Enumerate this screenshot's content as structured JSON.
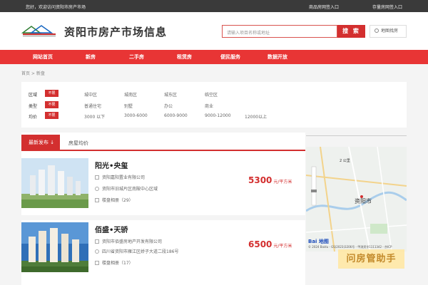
{
  "topbar": {
    "welcome": "您好，欢迎访问资阳市房产市场",
    "link_new_filing": "商品房网签入口",
    "link_used_filing": "存量房网签入口"
  },
  "header": {
    "site_title": "资阳市房产市场信息",
    "search_placeholder": "请输入项目名称或地址",
    "search_button": "搜 索",
    "map_find": "地图找房"
  },
  "nav": {
    "items": [
      "网站首页",
      "新房",
      "二手房",
      "租赁房",
      "便民服务",
      "数据开放"
    ]
  },
  "breadcrumb": "首页 > 新盘",
  "filters": {
    "rows": [
      {
        "label": "区域",
        "badge": "不限",
        "options": [
          "城中区",
          "城南区",
          "城东区",
          "临空区"
        ]
      },
      {
        "label": "类型",
        "badge": "不限",
        "options": [
          "普通住宅",
          "别墅",
          "办公",
          "商业"
        ]
      },
      {
        "label": "均价",
        "badge": "不限",
        "options": [
          "3000 以下",
          "3000-6000",
          "6000-9000",
          "9000-12000",
          "12000以上"
        ]
      }
    ]
  },
  "tabs": {
    "active": "最新发布 ↓",
    "other": "房屋均价"
  },
  "listings": [
    {
      "title": "阳光•央玺",
      "developer": "资阳嘉阳置业有限公司",
      "address": "资阳市旧城片区南陂中心区域",
      "sales_label": "楼盘相册（29）",
      "price": "5300",
      "unit": "元/平方米"
    },
    {
      "title": "佰盛•天骄",
      "developer": "资阳市佰盛房地产开发有限公司",
      "address": "四川省资阳市雁江区娇子大道二段186号",
      "sales_label": "楼盘相册（17）",
      "price": "6500",
      "unit": "元/平方米"
    }
  ],
  "map": {
    "city_label": "资阳市",
    "scale": "2 公里",
    "copyright": "© 2024 Baidu - GS(2023)3206号 - 甲测资字1111342 - 京ICP",
    "logo": "Bai 地图"
  },
  "watermark": "问房管助手",
  "colors": {
    "brand_red": "#d32f2f",
    "nav_red": "#e83535",
    "topbar": "#3a3a3a"
  }
}
